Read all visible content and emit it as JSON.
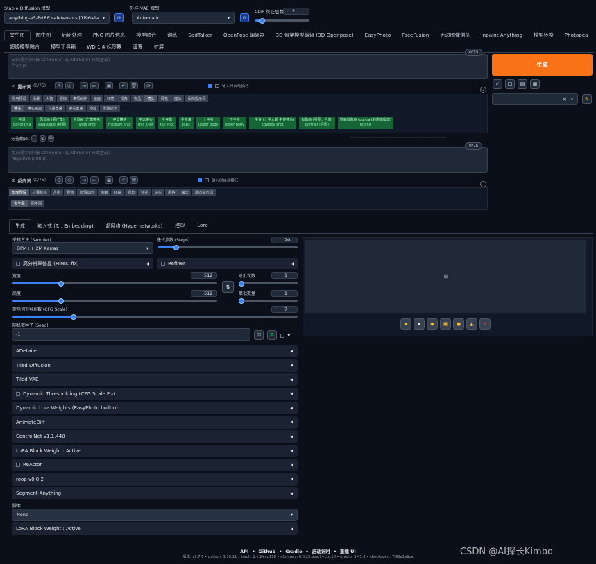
{
  "header": {
    "model_label": "Stable Diffusion 模型",
    "model_value": "anything-v5-PrtRE.safetensors [7f96a1a9ca]",
    "vae_label": "外挂 VAE 模型",
    "vae_value": "Automatic",
    "clip_label": "CLIP 终止层数",
    "clip_value": "2"
  },
  "main_tabs": [
    "文生图",
    "图生图",
    "后期处理",
    "PNG 图片信息",
    "模型融合",
    "训练",
    "SadTalker",
    "OpenPose 编辑器",
    "3D 骨架模型编辑 (3D Openpose)",
    "EasyPhoto",
    "FaceFusion",
    "无边图像浏览",
    "Inpaint Anything",
    "模型转换",
    "Photopea",
    "超级模型融合",
    "模型工具箱",
    "WD 1.4 标签器",
    "设置",
    "扩展"
  ],
  "prompt": {
    "counter": "0/75",
    "placeholder_line1": "正向提示词 (按 Ctrl+Enter 或 Alt+Enter 开始生成)",
    "placeholder_line2": "Prompt",
    "label": "提示词",
    "count": "(0/75)",
    "auto_newline": "输入时自动换行"
  },
  "tag_categories": [
    "常用预设",
    "场景",
    "人物",
    "服饰",
    "表情动作",
    "画面",
    "环境",
    "视角",
    "物品",
    "镜头",
    "风格",
    "魔法",
    "反向提示词"
  ],
  "tag_sub": [
    "镜头",
    "镜头画面",
    "光线角度",
    "镜头角度",
    "视线",
    "主题动作"
  ],
  "tag_chips": [
    {
      "cn": "全景",
      "en": "panorama"
    },
    {
      "cn": "风景画 (超广角)",
      "en": "landscape (横图)"
    },
    {
      "cn": "全景画 (广角镜头)",
      "en": "wide shot"
    },
    {
      "cn": "中景镜头",
      "en": "medium shot"
    },
    {
      "cn": "中远镜头",
      "en": "mid shot"
    },
    {
      "cn": "全身像",
      "en": "full shot"
    },
    {
      "cn": "半身像",
      "en": "bust"
    },
    {
      "cn": "上半身",
      "en": "upper body"
    },
    {
      "cn": "下半身",
      "en": "lower body"
    },
    {
      "cn": "上半身 (上半大腿 牛仔镜头)",
      "en": "cowboy shot"
    },
    {
      "cn": "肖像画 (竖图 / 人像)",
      "en": "portrait (竖图)"
    },
    {
      "cn": "侧面肖像画 (portrait的侧面版本)",
      "en": "profile"
    }
  ],
  "tag_hint": "标签翻译:",
  "neg": {
    "counter": "0/75",
    "placeholder_line1": "反向提示词 (按 Ctrl+Enter 或 Alt+Enter 开始生成)",
    "placeholder_line2": "Negative prompt",
    "label": "反向词",
    "count": "(0/75)",
    "auto_newline": "输入时自动换行"
  },
  "neg_categories": [
    "负面预设",
    "扩展标签",
    "人物",
    "服饰",
    "表情动作",
    "画面",
    "环境",
    "视角",
    "物品",
    "镜头",
    "风格",
    "魔法",
    "反向提示词"
  ],
  "neg_sub": [
    "文生图",
    "图生图"
  ],
  "generate": {
    "label": "生成"
  },
  "sub_tabs": [
    "生成",
    "嵌入式 (T.I. Embedding)",
    "超网络 (Hypernetworks)",
    "模型",
    "Lora"
  ],
  "sampler": {
    "label": "采样方法 (Sampler)",
    "value": "DPM++ 2M Karras"
  },
  "steps": {
    "label": "迭代步数 (Steps)",
    "value": "20",
    "fraction": 0.13
  },
  "hires": {
    "label": "高分辨率修复 (Hires. fix)"
  },
  "refiner": {
    "label": "Refiner"
  },
  "width": {
    "label": "宽度",
    "value": "512",
    "fraction": 0.23
  },
  "height": {
    "label": "高度",
    "value": "512",
    "fraction": 0.23
  },
  "batch_count": {
    "label": "总批次数",
    "value": "1",
    "fraction": 0.0
  },
  "batch_size": {
    "label": "单批数量",
    "value": "1",
    "fraction": 0.0
  },
  "cfg": {
    "label": "提示词引导系数 (CFG Scale)",
    "value": "7",
    "fraction": 0.2
  },
  "seed": {
    "label": "随机数种子 (Seed)",
    "value": "-1"
  },
  "accordions": [
    "ADetailer",
    "Tiled Diffusion",
    "Tiled VAE",
    "Dynamic Thresholding (CFG Scale Fix)",
    "Dynamic Lora Weights (EasyPhoto builtin)",
    "AnimateDiff",
    "ControlNet v1.1.440",
    "LoRA Block Weight : Active",
    "ReActor",
    "roop v0.0.2",
    "Segment Anything"
  ],
  "script": {
    "label": "脚本",
    "value": "None"
  },
  "last_accordion": "LoRA Block Weight : Active",
  "footer": {
    "links": [
      "API",
      "Github",
      "Gradio",
      "启动计时",
      "重载 UI"
    ],
    "version": "版本: v1.7.0  •  python: 3.10.11  •  torch: 2.1.2+cu118  •  xformers: 0.0.23.post1+cu118  •  gradio: 3.41.2  •  checkpoint: 7f96a1a9ca"
  },
  "watermark": "CSDN @AI探长Kimbo",
  "colors": {
    "accent": "#f97316",
    "primary": "#3b82f6",
    "tag_green": "#166534",
    "bg": "#0b0f19"
  }
}
